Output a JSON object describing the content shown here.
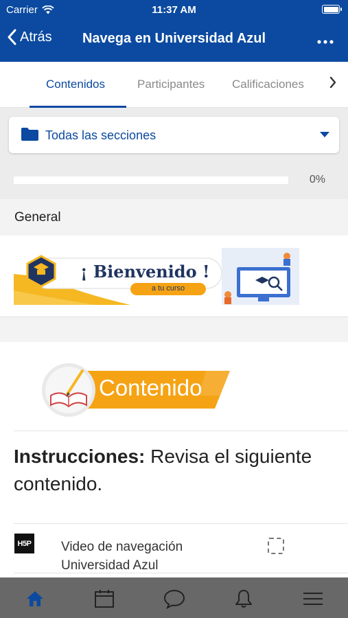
{
  "status_bar": {
    "carrier": "Carrier",
    "time": "11:37 AM"
  },
  "nav": {
    "back_label": "Atrás",
    "title": "Navega en Universidad Azul",
    "more_icon": "more-horizontal-icon"
  },
  "tabs": [
    {
      "label": "Contenidos",
      "active": true
    },
    {
      "label": "Participantes",
      "active": false
    },
    {
      "label": "Calificaciones",
      "active": false
    }
  ],
  "section_selector": {
    "label": "Todas las secciones"
  },
  "progress": {
    "percent_label": "0%",
    "value": 0
  },
  "section": {
    "title": "General"
  },
  "welcome_banner": {
    "heading": "¡ Bienvenido !",
    "subheading": "a tu curso"
  },
  "content_banner": {
    "label": "Contenido"
  },
  "instructions": {
    "bold": "Instrucciones:",
    "text": " Revisa el siguiente contenido."
  },
  "activity": {
    "icon_text": "H5P",
    "name": "Video de navegación Universidad Azul"
  },
  "bottom_nav": [
    {
      "name": "home",
      "icon": "home-icon",
      "active": true
    },
    {
      "name": "calendar",
      "icon": "calendar-icon",
      "active": false
    },
    {
      "name": "messages",
      "icon": "chat-icon",
      "active": false
    },
    {
      "name": "notifications",
      "icon": "bell-icon",
      "active": false
    },
    {
      "name": "menu",
      "icon": "menu-icon",
      "active": false
    }
  ],
  "colors": {
    "brand": "#0b4aa0",
    "accent_orange": "#f5a315",
    "bottom_bar": "#686868"
  }
}
